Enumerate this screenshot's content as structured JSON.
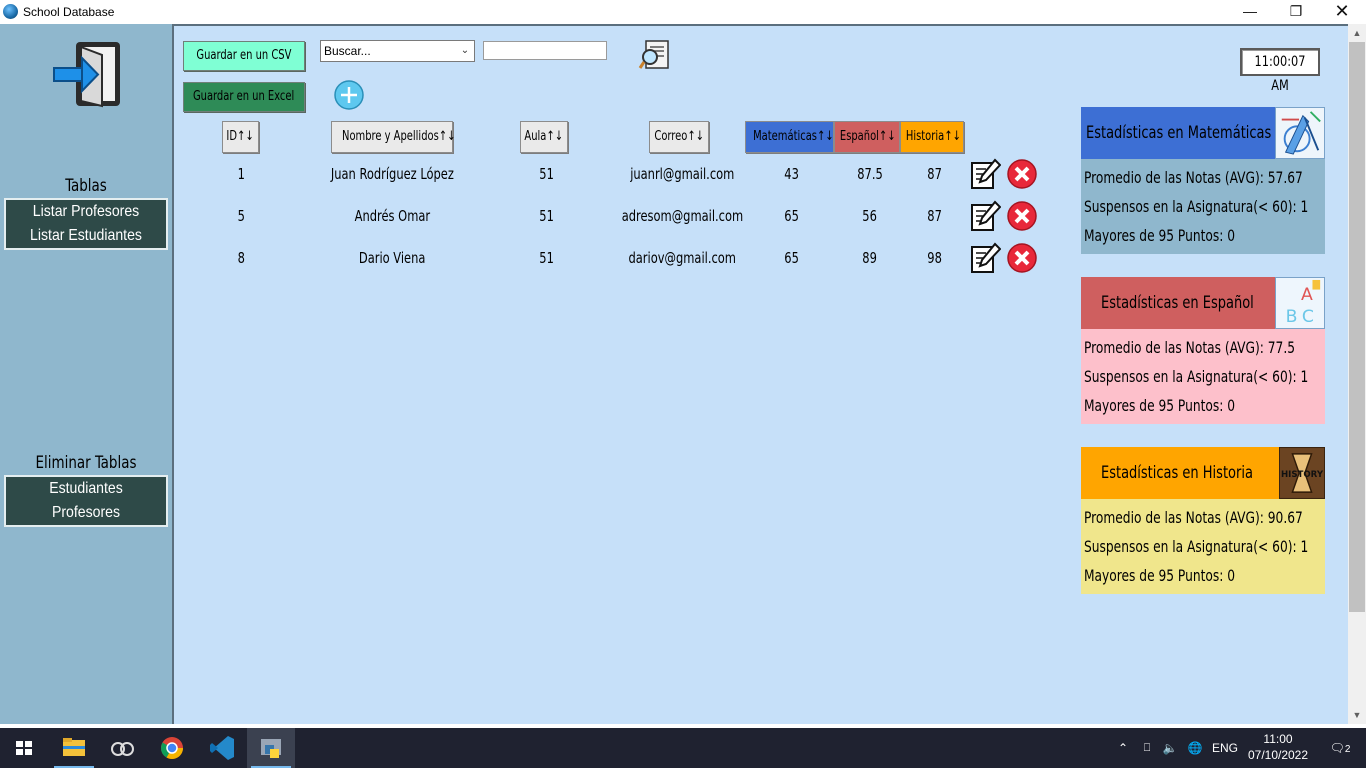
{
  "window": {
    "title": "School Database"
  },
  "sidebar": {
    "tables_heading": "Tablas",
    "list_teachers": "Listar Profesores",
    "list_students": "Listar Estudiantes",
    "delete_heading": "Eliminar Tablas",
    "delete_students": "Estudiantes",
    "delete_teachers": "Profesores"
  },
  "toolbar": {
    "save_csv": "Guardar en un CSV",
    "save_excel": "Guardar en un Excel",
    "search_select": "Buscar...",
    "search_value": ""
  },
  "clock": "11:00:07 AM",
  "table": {
    "headers": {
      "id": "ID↑↓",
      "name": "Nombre y Apellidos↑↓",
      "room": "Aula↑↓",
      "email": "Correo↑↓",
      "math": "Matemáticas↑↓",
      "spanish": "Español↑↓",
      "history": "Historia↑↓"
    },
    "rows": [
      {
        "id": "1",
        "name": "Juan Rodríguez López",
        "room": "51",
        "email": "juanrl@gmail.com",
        "math": "43",
        "spanish": "87.5",
        "history": "87"
      },
      {
        "id": "5",
        "name": "Andrés Omar",
        "room": "51",
        "email": "adresom@gmail.com",
        "math": "65",
        "spanish": "56",
        "history": "87"
      },
      {
        "id": "8",
        "name": "Dario Viena",
        "room": "51",
        "email": "dariov@gmail.com",
        "math": "65",
        "spanish": "89",
        "history": "98"
      }
    ]
  },
  "stats": {
    "math": {
      "title": "Estadísticas en Matemáticas",
      "avg": "Promedio de las Notas (AVG): 57.67",
      "fail": "Suspensos en la Asignatura(< 60): 1",
      "top": "Mayores de 95 Puntos: 0",
      "head_color": "#3d6fd4",
      "body_color": "#8fb7cd"
    },
    "spanish": {
      "title": "Estadísticas en Español",
      "avg": "Promedio de las Notas (AVG): 77.5",
      "fail": "Suspensos en la Asignatura(< 60): 1",
      "top": "Mayores de 95 Puntos: 0",
      "head_color": "#cf5f5f",
      "body_color": "#fdc0cb",
      "image_text": "ABC"
    },
    "history": {
      "title": "Estadísticas en Historia",
      "avg": "Promedio de las Notas (AVG): 90.67",
      "fail": "Suspensos en la Asignatura(< 60): 1",
      "top": "Mayores de 95 Puntos: 0",
      "head_color": "#ffa500",
      "body_color": "#f0e68c",
      "image_text": "HISTORY"
    }
  },
  "taskbar": {
    "language": "ENG",
    "time": "11:00",
    "date": "07/10/2022",
    "notifications": "2"
  },
  "colors": {
    "main_bg": "#c6e0f9",
    "sidebar_bg": "#8fb7cd",
    "csv_button": "#7fffd4",
    "excel_button": "#2e8b57",
    "math_header": "#3d6fd4",
    "spanish_header": "#cf5f5f",
    "history_header": "#ffa500"
  }
}
